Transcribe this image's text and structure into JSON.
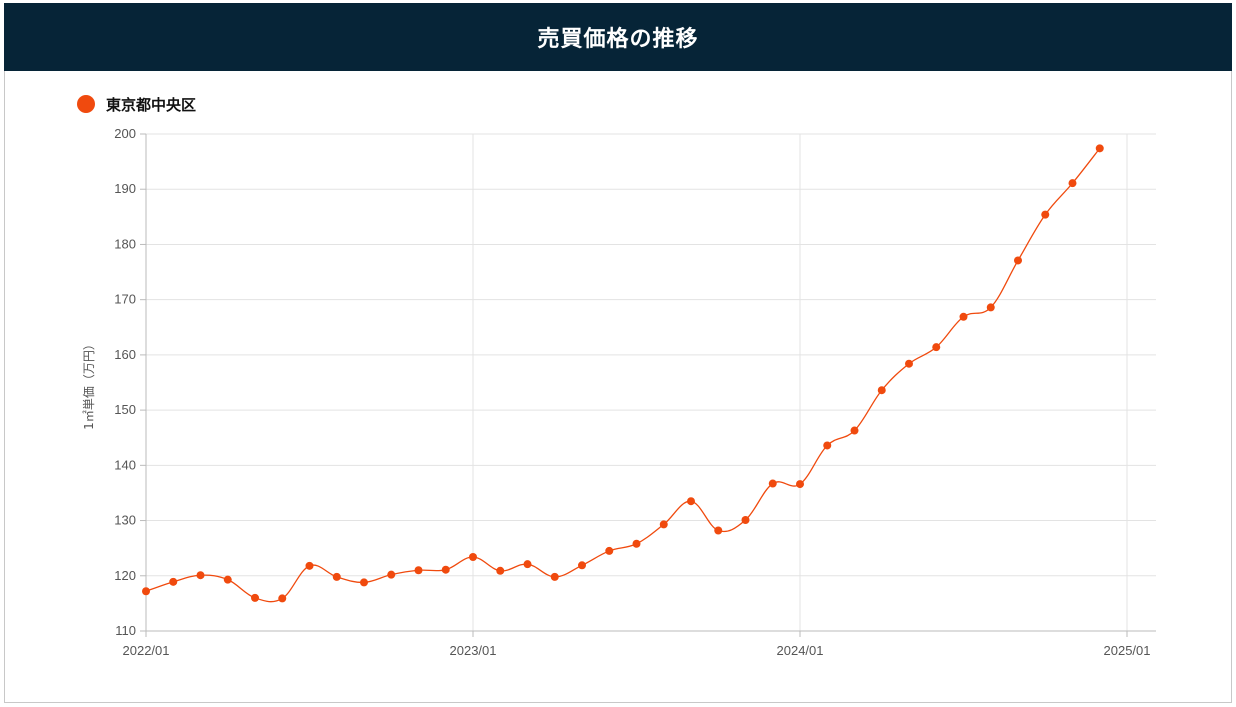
{
  "header": {
    "title": "売買価格の推移"
  },
  "chart_data": {
    "type": "line",
    "title": "売買価格の推移",
    "ylabel": "1㎡単価（万円）",
    "xlabel": "",
    "ylim": [
      110,
      200
    ],
    "yticks": [
      110,
      120,
      130,
      140,
      150,
      160,
      170,
      180,
      190,
      200
    ],
    "xlim": [
      "2022-01",
      "2025-01"
    ],
    "xticks": [
      "2022/01",
      "2023/01",
      "2024/01",
      "2025/01"
    ],
    "legend_position": "top-left",
    "grid": true,
    "series": [
      {
        "name": "東京都中央区",
        "color": "#f04a0e",
        "x": [
          "2022-01",
          "2022-02",
          "2022-03",
          "2022-04",
          "2022-05",
          "2022-06",
          "2022-07",
          "2022-08",
          "2022-09",
          "2022-10",
          "2022-11",
          "2022-12",
          "2023-01",
          "2023-02",
          "2023-03",
          "2023-04",
          "2023-05",
          "2023-06",
          "2023-07",
          "2023-08",
          "2023-09",
          "2023-10",
          "2023-11",
          "2023-12",
          "2024-01",
          "2024-02",
          "2024-03",
          "2024-04",
          "2024-05",
          "2024-06",
          "2024-07",
          "2024-08",
          "2024-09",
          "2024-10",
          "2024-11",
          "2024-12"
        ],
        "values": [
          117.2,
          118.9,
          120.1,
          119.3,
          116.0,
          115.9,
          121.8,
          119.8,
          118.8,
          120.2,
          121.0,
          121.1,
          123.4,
          120.9,
          122.1,
          119.8,
          121.9,
          124.5,
          125.8,
          129.3,
          133.5,
          128.2,
          130.1,
          136.7,
          136.6,
          143.6,
          146.3,
          153.6,
          158.4,
          161.4,
          166.9,
          168.6,
          177.1,
          185.4,
          191.1,
          197.4
        ]
      }
    ]
  }
}
